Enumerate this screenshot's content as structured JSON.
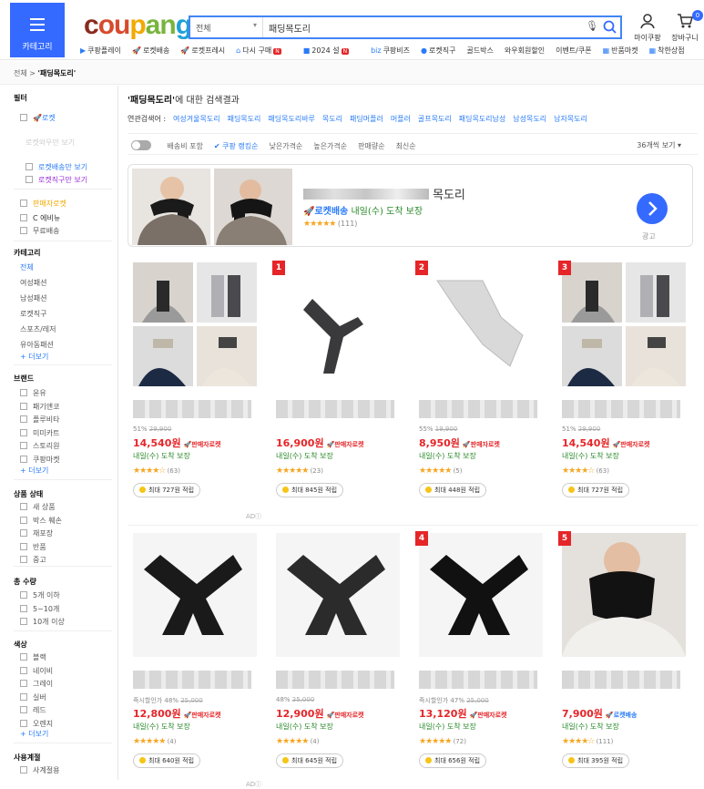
{
  "header": {
    "menu_label": "카테고리",
    "logo": [
      "c",
      "ou",
      "p",
      "an",
      "g"
    ],
    "search_category": "전체",
    "search_value": "패딩목도리",
    "my_label": "마이쿠팡",
    "cart_label": "장바구니",
    "cart_count": "0"
  },
  "subnav": [
    {
      "icon": "▶",
      "label": "쿠팡플레이"
    },
    {
      "icon": "🚀",
      "label": "로켓배송"
    },
    {
      "icon": "🚀",
      "label": "로켓프레시"
    },
    {
      "icon": "⌂",
      "label": "다시 구매",
      "badge": "N"
    },
    {
      "icon": "■",
      "label": "2024 설",
      "badge": "N"
    },
    {
      "icon": "biz",
      "label": "쿠팡비즈"
    },
    {
      "icon": "●",
      "label": "로켓직구"
    },
    {
      "icon": "",
      "label": "골드박스"
    },
    {
      "icon": "",
      "label": "와우회원할인"
    },
    {
      "icon": "",
      "label": "이벤트/쿠폰"
    },
    {
      "icon": "▦",
      "label": "반품마켓"
    },
    {
      "icon": "▦",
      "label": "착한상점"
    }
  ],
  "breadcrumb": {
    "root": "전체",
    "current": "'패딩목도리'"
  },
  "sidebar": {
    "filter_title": "필터",
    "rocket": "로켓",
    "rocket_sub": [
      "로켓와우만 보기",
      "로켓배송만 보기",
      "로켓직구만 보기"
    ],
    "delivery": [
      "판매자로켓",
      "C 에비뉴",
      "무료배송"
    ],
    "category_title": "카테고리",
    "categories": [
      "전체",
      "여성패션",
      "남성패션",
      "로켓직구",
      "스포츠/레저",
      "유아동패션"
    ],
    "more": "+ 더보기",
    "brand_title": "브랜드",
    "brands": [
      "윤유",
      "패기앤코",
      "플루비타",
      "미미카트",
      "스토리원",
      "쿠팡마켓"
    ],
    "condition_title": "상품 상태",
    "conditions": [
      "새 상품",
      "박스 훼손",
      "재포장",
      "반품",
      "중고"
    ],
    "qty_title": "총 수량",
    "qtys": [
      "5개 이하",
      "5~10개",
      "10개 이상"
    ],
    "color_title": "색상",
    "colors": [
      "블랙",
      "네이비",
      "그레이",
      "실버",
      "레드",
      "오렌지"
    ],
    "season_title": "사용계절",
    "seasons": [
      "사계절용"
    ]
  },
  "results": {
    "title_keyword": "'패딩목도리'",
    "title_suffix": "에 대한 검색결과",
    "related_label": "연관검색어 :",
    "related": [
      "여성겨울목도리",
      "패딩목도리",
      "패딩목도리바루",
      "목도리",
      "패딩머플러",
      "머플러",
      "골프목도리",
      "패딩목도리남성",
      "남성목도리",
      "남자목도리"
    ]
  },
  "sortbar": {
    "free_ship": "배송비 포함",
    "items": [
      "쿠팡 랭킹순",
      "낮은가격순",
      "높은가격순",
      "판매량순",
      "최신순"
    ],
    "per_page": "36개씩 보기"
  },
  "ad_banner": {
    "title": "목도리",
    "rocket": "🚀로켓배송",
    "delivery": "내일(수) 도착 보장",
    "stars": "★★★★★",
    "reviews": "(111)",
    "ad_label": "광고"
  },
  "products": [
    {
      "rank": "",
      "discount": "51%",
      "orig": "29,900",
      "price": "14,540원",
      "badge": "🚀판매자로켓",
      "delivery": "내일(수) 도착 보장",
      "stars": "★★★★☆",
      "reviews": "(63)",
      "points": "최대 727원 적립"
    },
    {
      "rank": "1",
      "discount": "",
      "orig": "",
      "price": "16,900원",
      "badge": "🚀판매자로켓",
      "delivery": "내일(수) 도착 보장",
      "stars": "★★★★★",
      "reviews": "(23)",
      "points": "최대 845원 적립"
    },
    {
      "rank": "2",
      "discount": "55%",
      "orig": "19,900",
      "price": "8,950원",
      "badge": "🚀판매자로켓",
      "delivery": "내일(수) 도착 보장",
      "stars": "★★★★★",
      "reviews": "(5)",
      "points": "최대 448원 적립"
    },
    {
      "rank": "3",
      "discount": "51%",
      "orig": "29,900",
      "price": "14,540원",
      "badge": "🚀판매자로켓",
      "delivery": "내일(수) 도착 보장",
      "stars": "★★★★☆",
      "reviews": "(63)",
      "points": "최대 727원 적립"
    },
    {
      "rank": "",
      "discount": "즉시할인가 48%",
      "orig": "25,000",
      "price": "12,800원",
      "badge": "🚀판매자로켓",
      "delivery": "내일(수) 도착 보장",
      "stars": "★★★★★",
      "reviews": "(4)",
      "points": "최대 640원 적립"
    },
    {
      "rank": "",
      "discount": "48%",
      "orig": "25,000",
      "price": "12,900원",
      "badge": "🚀판매자로켓",
      "delivery": "내일(수) 도착 보장",
      "stars": "★★★★★",
      "reviews": "(4)",
      "points": "최대 645원 적립"
    },
    {
      "rank": "4",
      "discount": "즉시할인가 47%",
      "orig": "25,000",
      "price": "13,120원",
      "badge": "🚀판매자로켓",
      "delivery": "내일(수) 도착 보장",
      "stars": "★★★★★",
      "reviews": "(72)",
      "points": "최대 656원 적립"
    },
    {
      "rank": "5",
      "discount": "",
      "orig": "",
      "price": "7,900원",
      "badge": "🚀로켓배송",
      "delivery": "내일(수) 도착 보장",
      "stars": "★★★★☆",
      "reviews": "(111)",
      "points": "최대 395원 적립"
    }
  ],
  "ad_small": "AD",
  "colors": {
    "accent": "#346aff",
    "price": "#e52528",
    "rocket": "#2a7cf7",
    "delivery": "#2a8a2a"
  }
}
